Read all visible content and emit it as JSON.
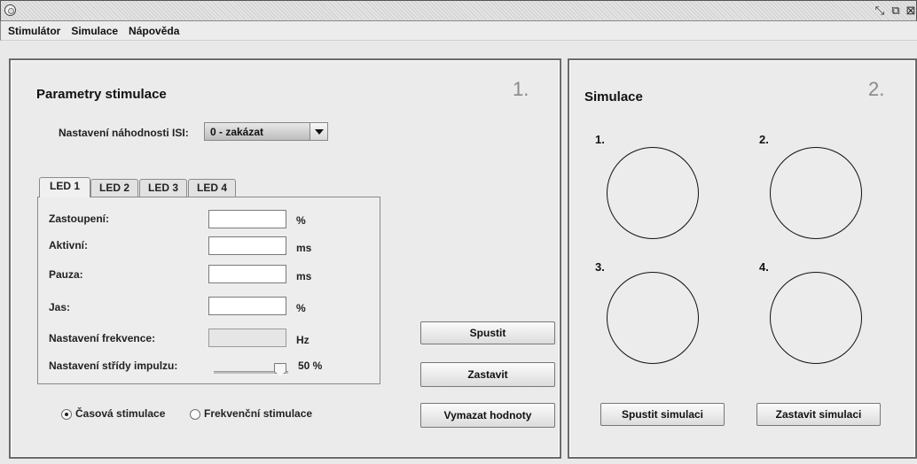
{
  "window": {
    "title": "",
    "controls": {
      "minimize": "⤡",
      "maximize": "⧉",
      "close": "⊠"
    }
  },
  "menu": [
    "Stimulátor",
    "Simulace",
    "Nápověda"
  ],
  "left_panel": {
    "title": "Parametry stimulace",
    "number": "1.",
    "isi_label": "Nastavení náhodnosti ISI:",
    "isi_value": "0 - zakázat",
    "tabs": [
      {
        "label": "LED ",
        "num": "1",
        "active": true
      },
      {
        "label": "LED ",
        "num": "2",
        "active": false
      },
      {
        "label": "LED ",
        "num": "3",
        "active": false
      },
      {
        "label": "LED ",
        "num": "4",
        "active": false
      }
    ],
    "fields": {
      "zastoupeni": {
        "label": "Zastoupení:",
        "value": "",
        "unit": "%"
      },
      "aktivni": {
        "label": "Aktivní:",
        "value": "",
        "unit": "ms"
      },
      "pauza": {
        "label": "Pauza:",
        "value": "",
        "unit": "ms"
      },
      "jas": {
        "label": "Jas:",
        "value": "",
        "unit": "%"
      },
      "frekvence": {
        "label": "Nastavení frekvence:",
        "value": "",
        "unit": "Hz"
      },
      "strida": {
        "label": "Nastavení střídy impulzu:",
        "value_text": "50 %",
        "value": 50
      }
    },
    "radios": {
      "casova": {
        "label": "Časová stimulace",
        "checked": true
      },
      "frekvencni": {
        "label": "Frekvenční stimulace",
        "checked": false
      }
    },
    "buttons": {
      "spustit": "Spustit",
      "zastavit": "Zastavit",
      "vymazat": "Vymazat hodnoty"
    }
  },
  "right_panel": {
    "title": "Simulace",
    "number": "2.",
    "circles": [
      "1.",
      "2.",
      "3.",
      "4."
    ],
    "buttons": {
      "spustit_sim": "Spustit simulaci",
      "zastavit_sim": "Zastavit simulaci"
    }
  },
  "colors": {
    "background": "#e9e9e9",
    "border": "#6a6a6a",
    "panel_number": "#8a8a8a"
  }
}
